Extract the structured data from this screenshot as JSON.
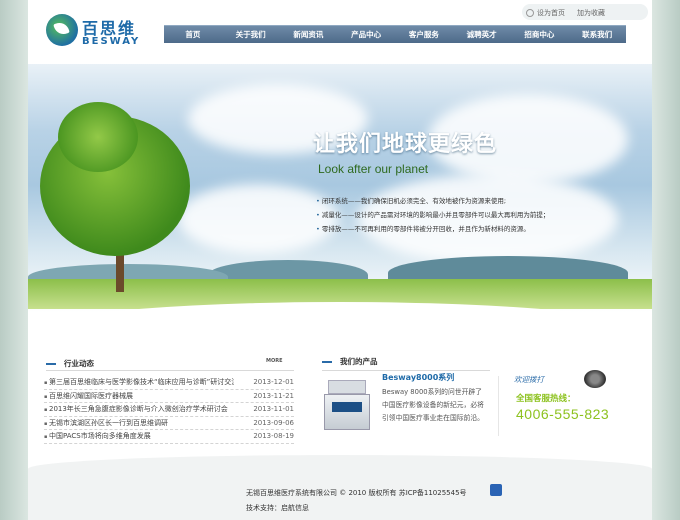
{
  "logo": {
    "cn": "百思维",
    "en": "BESWAY"
  },
  "toplinks": {
    "home": "设为首页",
    "favorite": "加为收藏"
  },
  "nav": [
    "首页",
    "关于我们",
    "新闻资讯",
    "产品中心",
    "客户服务",
    "诚聘英才",
    "招商中心",
    "联系我们"
  ],
  "banner": {
    "title": "让我们地球更绿色",
    "subtitle": "Look after our planet",
    "bullets": [
      "闭环系统——我们确保旧机必须完全、有效地被作为资源来使用;",
      "减量化——设计的产品需对环境的影响最小并且零部件可以最大再利用为前提；",
      "零排放——不可再利用的零部件将被分开回收，并且作为新材料的资源。"
    ]
  },
  "news": {
    "heading": "行业动态",
    "more": "MORE",
    "items": [
      {
        "title": "第三届百思维临床与医学影像技术“临床应用与诊断”研讨交流会",
        "date": "2013-12-01"
      },
      {
        "title": "百思维闪耀国际医疗器械展",
        "date": "2013-11-21"
      },
      {
        "title": "2013年长三角急腹症影像诊断与介入微创治疗学术研讨会",
        "date": "2013-11-01"
      },
      {
        "title": "无锡市滨湖区孙区长一行到百思维调研",
        "date": "2013-09-06"
      },
      {
        "title": "中国PACS市场将向多维角度发展",
        "date": "2013-08-19"
      }
    ]
  },
  "products": {
    "heading": "我们的产品",
    "name": "Besway8000系列",
    "desc": "Besway 8000系列的问世开辟了中国医疗影像设备的新纪元，必将引领中国医疗事业走在国际前沿。"
  },
  "service": {
    "welcome": "欢迎拨打",
    "hotline_label": "全国客服热线：",
    "phone": "4006-555-823"
  },
  "footer": {
    "copyright": "无锡百思维医疗系统有限公司 © 2010 版权所有 苏ICP备11025545号",
    "support": "技术支持：启航信息"
  }
}
